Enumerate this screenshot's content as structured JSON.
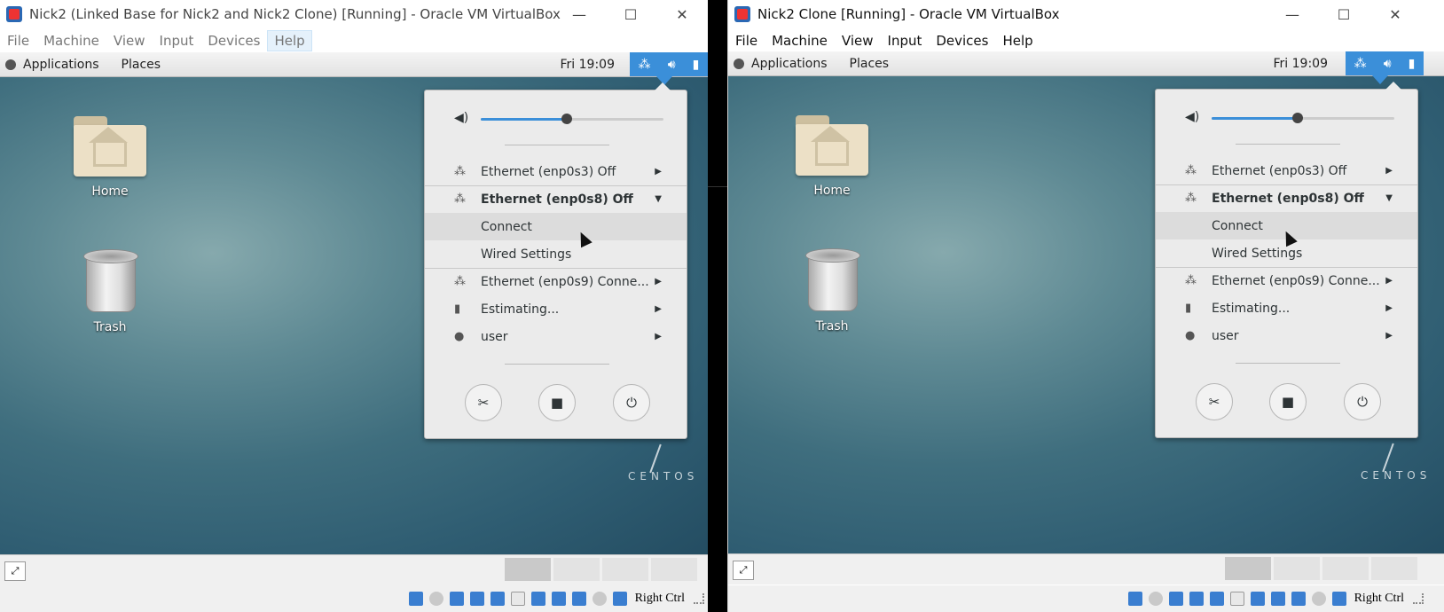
{
  "windows": [
    {
      "title": "Nick2 (Linked Base for Nick2 and Nick2 Clone) [Running] - Oracle VM VirtualBox",
      "menu": [
        "File",
        "Machine",
        "View",
        "Input",
        "Devices",
        "Help"
      ],
      "active_menu": "Help",
      "topbar": {
        "applications": "Applications",
        "places": "Places",
        "clock": "Fri 19:09"
      },
      "desktop_icons": {
        "home": "Home",
        "trash": "Trash"
      },
      "brand": "CENTOS",
      "popup": {
        "volume_level": 0.47,
        "items": [
          {
            "label": "Ethernet (enp0s3) Off",
            "icon": "network-wired-off-icon"
          },
          {
            "label": "Ethernet (enp0s8) Off",
            "icon": "network-wired-off-icon",
            "expanded": true
          },
          {
            "label": "Connect"
          },
          {
            "label": "Wired Settings"
          },
          {
            "label": "Ethernet (enp0s9) Conne...",
            "icon": "network-wired-icon"
          },
          {
            "label": "Estimating...",
            "icon": "battery-icon"
          },
          {
            "label": "user",
            "icon": "user-icon"
          }
        ],
        "buttons": [
          "settings-icon",
          "lock-icon",
          "power-icon"
        ]
      },
      "host_key": "Right Ctrl"
    },
    {
      "title": "Nick2 Clone [Running] - Oracle VM VirtualBox",
      "menu": [
        "File",
        "Machine",
        "View",
        "Input",
        "Devices",
        "Help"
      ],
      "topbar": {
        "applications": "Applications",
        "places": "Places",
        "clock": "Fri 19:09"
      },
      "desktop_icons": {
        "home": "Home",
        "trash": "Trash"
      },
      "brand": "CENTOS",
      "popup": {
        "volume_level": 0.47,
        "items": [
          {
            "label": "Ethernet (enp0s3) Off",
            "icon": "network-wired-off-icon"
          },
          {
            "label": "Ethernet (enp0s8) Off",
            "icon": "network-wired-off-icon",
            "expanded": true
          },
          {
            "label": "Connect"
          },
          {
            "label": "Wired Settings"
          },
          {
            "label": "Ethernet (enp0s9) Conne...",
            "icon": "network-wired-icon"
          },
          {
            "label": "Estimating...",
            "icon": "battery-icon"
          },
          {
            "label": "user",
            "icon": "user-icon"
          }
        ],
        "buttons": [
          "settings-icon",
          "lock-icon",
          "power-icon"
        ]
      },
      "host_key": "Right Ctrl"
    }
  ],
  "colors": {
    "accent": "#3b8fd9",
    "popup_bg": "#ebebeb",
    "highlight": "#dcdcdc"
  }
}
